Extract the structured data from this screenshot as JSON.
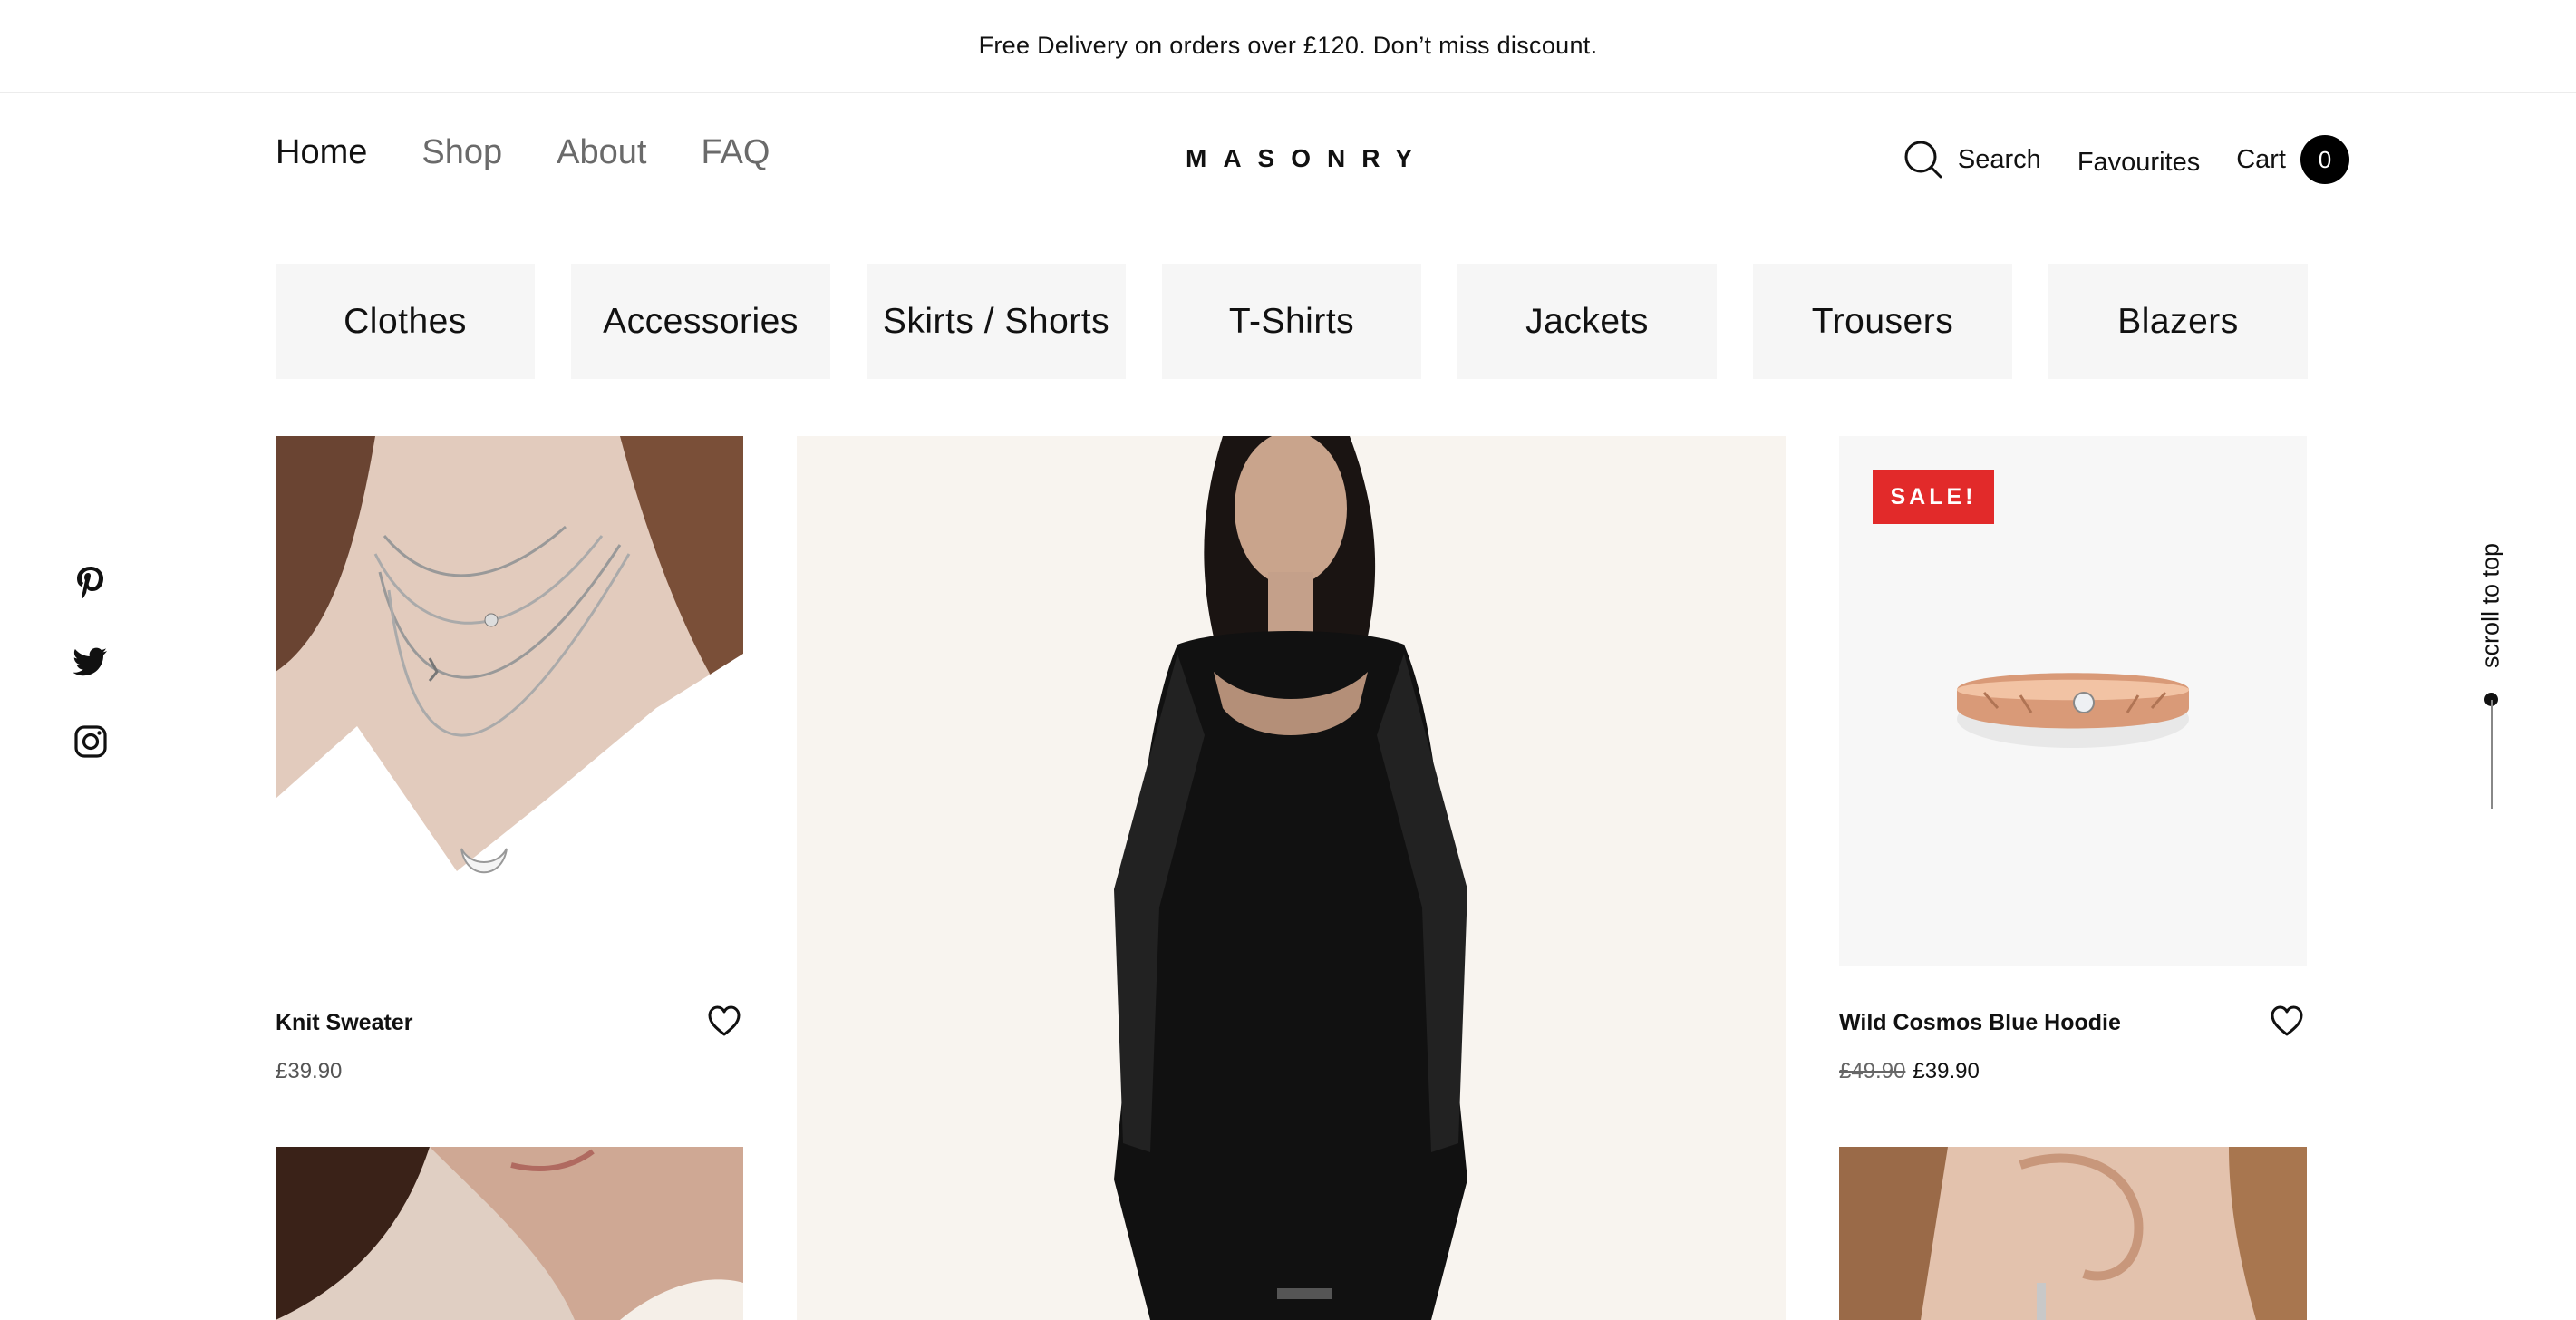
{
  "announcement": "Free Delivery on orders over £120. Don’t miss discount.",
  "nav": {
    "items": [
      {
        "label": "Home",
        "active": true
      },
      {
        "label": "Shop",
        "active": false
      },
      {
        "label": "About",
        "active": false
      },
      {
        "label": "FAQ",
        "active": false
      }
    ]
  },
  "logo": "MASONRY",
  "actions": {
    "search_label": "Search",
    "favourites_label": "Favourites",
    "cart_label": "Cart",
    "cart_count": "0"
  },
  "categories": [
    "Clothes",
    "Accessories",
    "Skirts / Shorts",
    "T-Shirts",
    "Jackets",
    "Trousers",
    "Blazers"
  ],
  "social": [
    "pinterest-icon",
    "twitter-icon",
    "instagram-icon"
  ],
  "scroll_to_top": "scroll to top",
  "products": [
    {
      "name": "Knit Sweater",
      "price": "£39.90"
    },
    {
      "name": "Wild Cosmos Blue Hoodie",
      "old_price": "£49.90",
      "price": "£39.90",
      "badge": "SALE!"
    }
  ],
  "colors": {
    "sale": "#e22a2a",
    "text": "#111111",
    "muted": "#6a6a6a",
    "category_bg": "#f6f6f6"
  }
}
